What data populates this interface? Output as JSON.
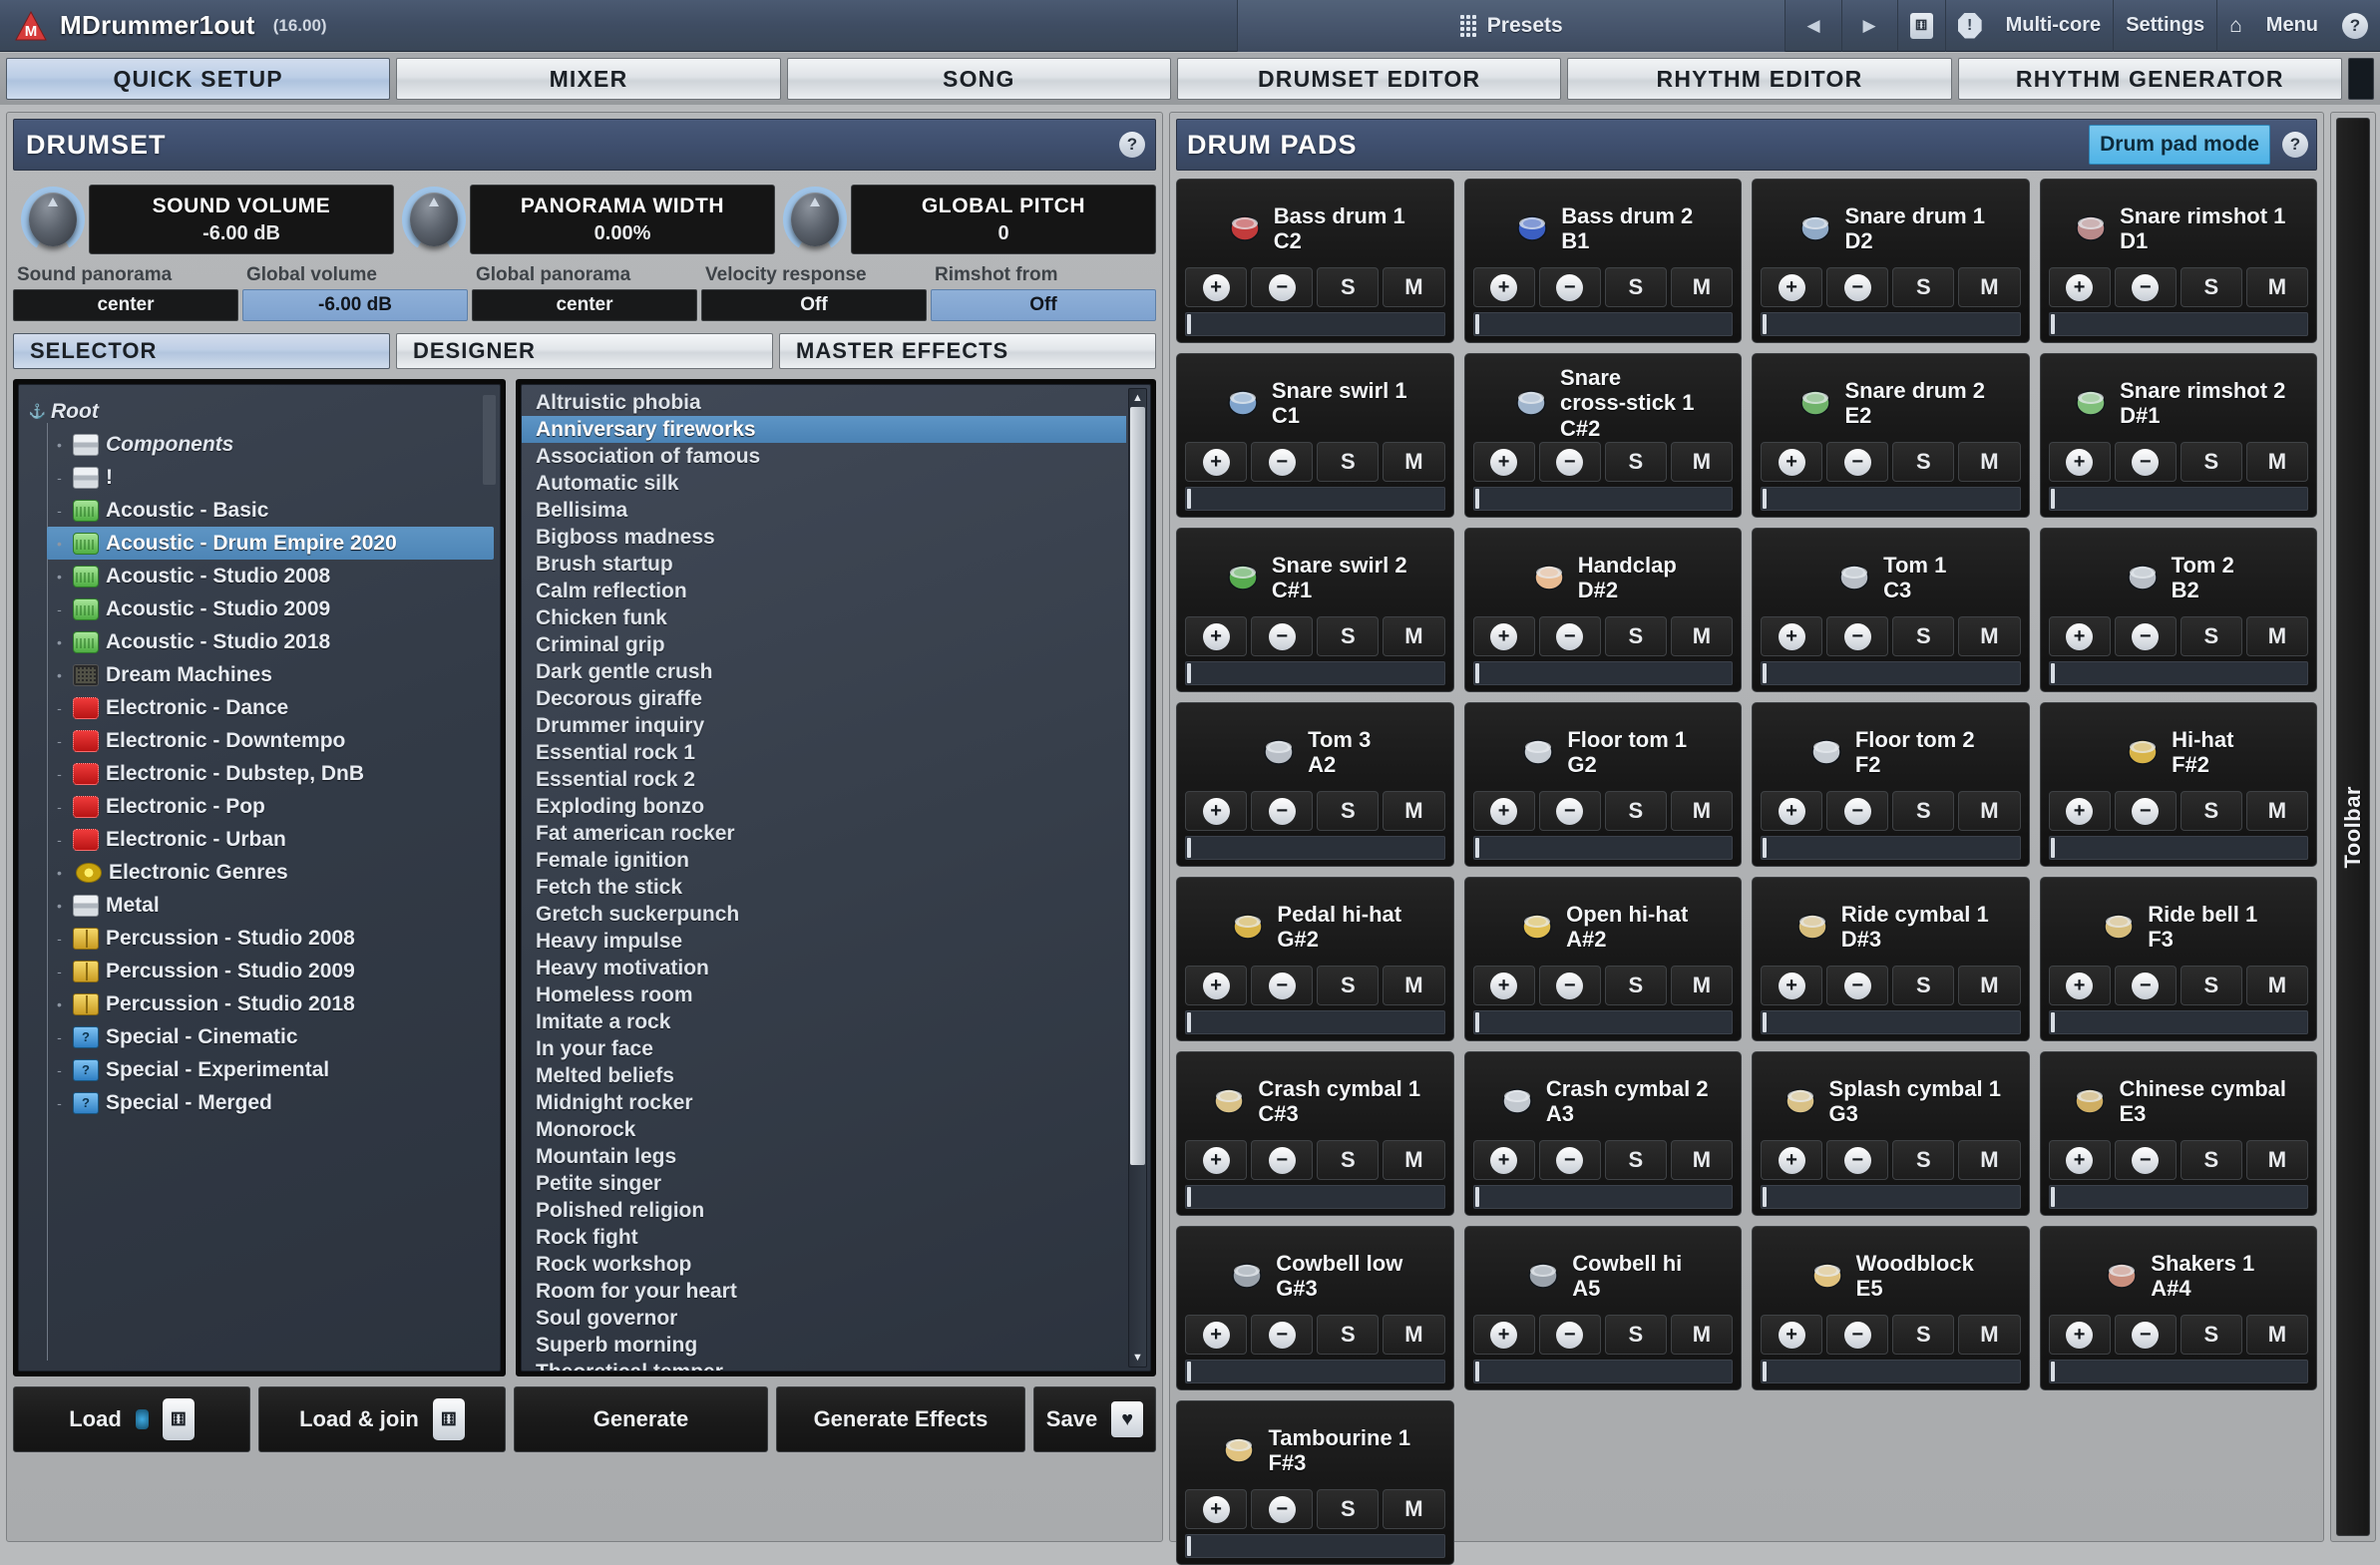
{
  "titlebar": {
    "app_name": "MDrummer1out",
    "version": "(16.00)",
    "presets_label": "Presets",
    "prev_label": "◀",
    "next_label": "▶",
    "dice_label": "⚅",
    "multicore_label": "Multi-core",
    "settings_label": "Settings",
    "home_label": "⌂",
    "menu_label": "Menu",
    "help_label": "?",
    "alert_label": "!"
  },
  "main_tabs": [
    {
      "label": "QUICK SETUP",
      "active": true
    },
    {
      "label": "MIXER",
      "active": false
    },
    {
      "label": "SONG",
      "active": false
    },
    {
      "label": "DRUMSET EDITOR",
      "active": false
    },
    {
      "label": "RHYTHM EDITOR",
      "active": false
    },
    {
      "label": "RHYTHM GENERATOR",
      "active": false
    }
  ],
  "drumset": {
    "title": "DRUMSET",
    "help_label": "?",
    "knobs": [
      {
        "name": "SOUND VOLUME",
        "value": "-6.00 dB"
      },
      {
        "name": "PANORAMA WIDTH",
        "value": "0.00%"
      },
      {
        "name": "GLOBAL PITCH",
        "value": "0"
      }
    ],
    "fields": [
      {
        "label": "Sound panorama",
        "value": "center",
        "highlight": false
      },
      {
        "label": "Global volume",
        "value": "-6.00 dB",
        "highlight": true
      },
      {
        "label": "Global panorama",
        "value": "center",
        "highlight": false
      },
      {
        "label": "Velocity response",
        "value": "Off",
        "highlight": false
      },
      {
        "label": "Rimshot from",
        "value": "Off",
        "highlight": true
      }
    ],
    "sub_tabs": [
      {
        "label": "SELECTOR",
        "active": true
      },
      {
        "label": "DESIGNER",
        "active": false
      },
      {
        "label": "MASTER EFFECTS",
        "active": false
      }
    ],
    "tree": [
      {
        "label": "Root",
        "icon": "anchor-icon",
        "indent": 0,
        "selected": false,
        "italic": true,
        "expander": ""
      },
      {
        "label": "Components",
        "icon": "stack-icon",
        "indent": 1,
        "selected": false,
        "italic": true,
        "expander": "•"
      },
      {
        "label": "!",
        "icon": "stack-icon",
        "indent": 1,
        "selected": false,
        "italic": false,
        "expander": "-"
      },
      {
        "label": "Acoustic - Basic",
        "icon": "drum-green-icon",
        "indent": 1,
        "selected": false,
        "italic": false,
        "expander": "-"
      },
      {
        "label": "Acoustic - Drum Empire 2020",
        "icon": "drum-green-icon",
        "indent": 1,
        "selected": true,
        "italic": false,
        "expander": "•"
      },
      {
        "label": "Acoustic - Studio 2008",
        "icon": "drum-green-icon",
        "indent": 1,
        "selected": false,
        "italic": false,
        "expander": "•"
      },
      {
        "label": "Acoustic - Studio 2009",
        "icon": "drum-green-icon",
        "indent": 1,
        "selected": false,
        "italic": false,
        "expander": "-"
      },
      {
        "label": "Acoustic - Studio 2018",
        "icon": "drum-green-icon",
        "indent": 1,
        "selected": false,
        "italic": false,
        "expander": "•"
      },
      {
        "label": "Dream Machines",
        "icon": "grid-machine-icon",
        "indent": 1,
        "selected": false,
        "italic": false,
        "expander": "•"
      },
      {
        "label": "Electronic - Dance",
        "icon": "drum-red-icon",
        "indent": 1,
        "selected": false,
        "italic": false,
        "expander": "-"
      },
      {
        "label": "Electronic - Downtempo",
        "icon": "drum-red-icon",
        "indent": 1,
        "selected": false,
        "italic": false,
        "expander": "-"
      },
      {
        "label": "Electronic - Dubstep, DnB",
        "icon": "drum-red-icon",
        "indent": 1,
        "selected": false,
        "italic": false,
        "expander": "-"
      },
      {
        "label": "Electronic - Pop",
        "icon": "drum-red-icon",
        "indent": 1,
        "selected": false,
        "italic": false,
        "expander": "-"
      },
      {
        "label": "Electronic - Urban",
        "icon": "drum-red-icon",
        "indent": 1,
        "selected": false,
        "italic": false,
        "expander": "-"
      },
      {
        "label": "Electronic Genres",
        "icon": "disc-yellow-icon",
        "indent": 1,
        "selected": false,
        "italic": false,
        "expander": "•"
      },
      {
        "label": "Metal",
        "icon": "stack-icon",
        "indent": 1,
        "selected": false,
        "italic": false,
        "expander": "•"
      },
      {
        "label": "Percussion - Studio 2008",
        "icon": "bongo-gold-icon",
        "indent": 1,
        "selected": false,
        "italic": false,
        "expander": "-"
      },
      {
        "label": "Percussion - Studio 2009",
        "icon": "bongo-gold-icon",
        "indent": 1,
        "selected": false,
        "italic": false,
        "expander": "-"
      },
      {
        "label": "Percussion - Studio 2018",
        "icon": "bongo-gold-icon",
        "indent": 1,
        "selected": false,
        "italic": false,
        "expander": "•"
      },
      {
        "label": "Special - Cinematic",
        "icon": "question-blue-icon",
        "indent": 1,
        "selected": false,
        "italic": false,
        "expander": "-"
      },
      {
        "label": "Special - Experimental",
        "icon": "question-blue-icon",
        "indent": 1,
        "selected": false,
        "italic": false,
        "expander": "-"
      },
      {
        "label": "Special - Merged",
        "icon": "question-blue-icon",
        "indent": 1,
        "selected": false,
        "italic": false,
        "expander": "-"
      }
    ],
    "presets": [
      {
        "label": "Altruistic phobia",
        "selected": false
      },
      {
        "label": "Anniversary fireworks",
        "selected": true
      },
      {
        "label": "Association of famous",
        "selected": false
      },
      {
        "label": "Automatic silk",
        "selected": false
      },
      {
        "label": "Bellisima",
        "selected": false
      },
      {
        "label": "Bigboss madness",
        "selected": false
      },
      {
        "label": "Brush startup",
        "selected": false
      },
      {
        "label": "Calm reflection",
        "selected": false
      },
      {
        "label": "Chicken funk",
        "selected": false
      },
      {
        "label": "Criminal grip",
        "selected": false
      },
      {
        "label": "Dark gentle crush",
        "selected": false
      },
      {
        "label": "Decorous giraffe",
        "selected": false
      },
      {
        "label": "Drummer inquiry",
        "selected": false
      },
      {
        "label": "Essential rock 1",
        "selected": false
      },
      {
        "label": "Essential rock 2",
        "selected": false
      },
      {
        "label": "Exploding bonzo",
        "selected": false
      },
      {
        "label": "Fat american rocker",
        "selected": false
      },
      {
        "label": "Female ignition",
        "selected": false
      },
      {
        "label": "Fetch the stick",
        "selected": false
      },
      {
        "label": "Gretch suckerpunch",
        "selected": false
      },
      {
        "label": "Heavy impulse",
        "selected": false
      },
      {
        "label": "Heavy motivation",
        "selected": false
      },
      {
        "label": "Homeless room",
        "selected": false
      },
      {
        "label": "Imitate a rock",
        "selected": false
      },
      {
        "label": "In your face",
        "selected": false
      },
      {
        "label": "Melted beliefs",
        "selected": false
      },
      {
        "label": "Midnight rocker",
        "selected": false
      },
      {
        "label": "Monorock",
        "selected": false
      },
      {
        "label": "Mountain legs",
        "selected": false
      },
      {
        "label": "Petite singer",
        "selected": false
      },
      {
        "label": "Polished religion",
        "selected": false
      },
      {
        "label": "Rock fight",
        "selected": false
      },
      {
        "label": "Rock workshop",
        "selected": false
      },
      {
        "label": "Room for your heart",
        "selected": false
      },
      {
        "label": "Soul governor",
        "selected": false
      },
      {
        "label": "Superb morning",
        "selected": false
      },
      {
        "label": "Theoretical temper",
        "selected": false
      }
    ],
    "buttons": {
      "load": "Load",
      "load_join": "Load & join",
      "generate": "Generate",
      "generate_effects": "Generate\nEffects",
      "save": "Save",
      "dice_icon": "⚅",
      "heart_icon": "♥"
    }
  },
  "drum_pads": {
    "title": "DRUM PADS",
    "mode_label": "Drum pad mode",
    "help_label": "?",
    "controls": {
      "add": "+",
      "remove": "−",
      "solo": "S",
      "mute": "M"
    },
    "pads": [
      {
        "name": "Bass drum 1",
        "note": "C2",
        "icon": "bass-drum-red-icon",
        "color": "#c23b3b"
      },
      {
        "name": "Bass drum 2",
        "note": "B1",
        "icon": "bass-drum-blue-icon",
        "color": "#3b5fc2"
      },
      {
        "name": "Snare drum 1",
        "note": "D2",
        "icon": "snare-drum-icon",
        "color": "#8fa9c6"
      },
      {
        "name": "Snare rimshot 1",
        "note": "D1",
        "icon": "snare-rimshot-icon",
        "color": "#b98a8a"
      },
      {
        "name": "Snare swirl 1",
        "note": "C1",
        "icon": "snare-swirl-icon",
        "color": "#7fa3cc"
      },
      {
        "name": "Snare\ncross-stick 1",
        "note": "C#2",
        "icon": "snare-crossstick-icon",
        "color": "#9fb4cc"
      },
      {
        "name": "Snare drum 2",
        "note": "E2",
        "icon": "snare-drum-green-icon",
        "color": "#6fb26a"
      },
      {
        "name": "Snare rimshot 2",
        "note": "D#1",
        "icon": "snare-rimshot-green-icon",
        "color": "#7fbf7a"
      },
      {
        "name": "Snare swirl 2",
        "note": "C#1",
        "icon": "snare-swirl-green-icon",
        "color": "#57ab4f"
      },
      {
        "name": "Handclap",
        "note": "D#2",
        "icon": "handclap-icon",
        "color": "#e8bb92"
      },
      {
        "name": "Tom 1",
        "note": "C3",
        "icon": "tom-icon",
        "color": "#b8bec6"
      },
      {
        "name": "Tom 2",
        "note": "B2",
        "icon": "tom-icon",
        "color": "#b8bec6"
      },
      {
        "name": "Tom 3",
        "note": "A2",
        "icon": "tom-icon",
        "color": "#b8bec6"
      },
      {
        "name": "Floor tom 1",
        "note": "G2",
        "icon": "floor-tom-icon",
        "color": "#c6ccd3"
      },
      {
        "name": "Floor tom 2",
        "note": "F2",
        "icon": "floor-tom-icon",
        "color": "#c6ccd3"
      },
      {
        "name": "Hi-hat",
        "note": "F#2",
        "icon": "hihat-icon",
        "color": "#d8b449"
      },
      {
        "name": "Pedal hi-hat",
        "note": "G#2",
        "icon": "pedal-hihat-icon",
        "color": "#d8b449"
      },
      {
        "name": "Open hi-hat",
        "note": "A#2",
        "icon": "open-hihat-icon",
        "color": "#e0be52"
      },
      {
        "name": "Ride cymbal 1",
        "note": "D#3",
        "icon": "ride-cymbal-icon",
        "color": "#d6bd7c"
      },
      {
        "name": "Ride bell 1",
        "note": "F3",
        "icon": "ride-bell-icon",
        "color": "#d6bd7c"
      },
      {
        "name": "Crash cymbal 1",
        "note": "C#3",
        "icon": "crash-cymbal-icon",
        "color": "#d9c186"
      },
      {
        "name": "Crash cymbal 2",
        "note": "A3",
        "icon": "crash-cymbal-icon",
        "color": "#cbb municipality"
      },
      {
        "name": "Splash cymbal 1",
        "note": "G3",
        "icon": "splash-cymbal-icon",
        "color": "#d9c186"
      },
      {
        "name": "Chinese cymbal",
        "note": "E3",
        "icon": "chinese-cymbal-icon",
        "color": "#cfae63"
      },
      {
        "name": "Cowbell low",
        "note": "G#3",
        "icon": "cowbell-icon",
        "color": "#9aa2ab"
      },
      {
        "name": "Cowbell hi",
        "note": "A5",
        "icon": "cowbell-icon",
        "color": "#9aa2ab"
      },
      {
        "name": "Woodblock",
        "note": "E5",
        "icon": "woodblock-icon",
        "color": "#e0c27e"
      },
      {
        "name": "Shakers 1",
        "note": "A#4",
        "icon": "shakers-icon",
        "color": "#c98f7e"
      },
      {
        "name": "Tambourine 1",
        "note": "F#3",
        "icon": "tambourine-icon",
        "color": "#e0c27e"
      }
    ]
  },
  "toolbar_strip": {
    "label": "Toolbar"
  },
  "colors": {
    "accent_blue": "#4fb3e6",
    "selection_blue": "#5d95c6",
    "panel_header": "#3e4e6d",
    "chrome_gray": "#b0b3b6"
  }
}
